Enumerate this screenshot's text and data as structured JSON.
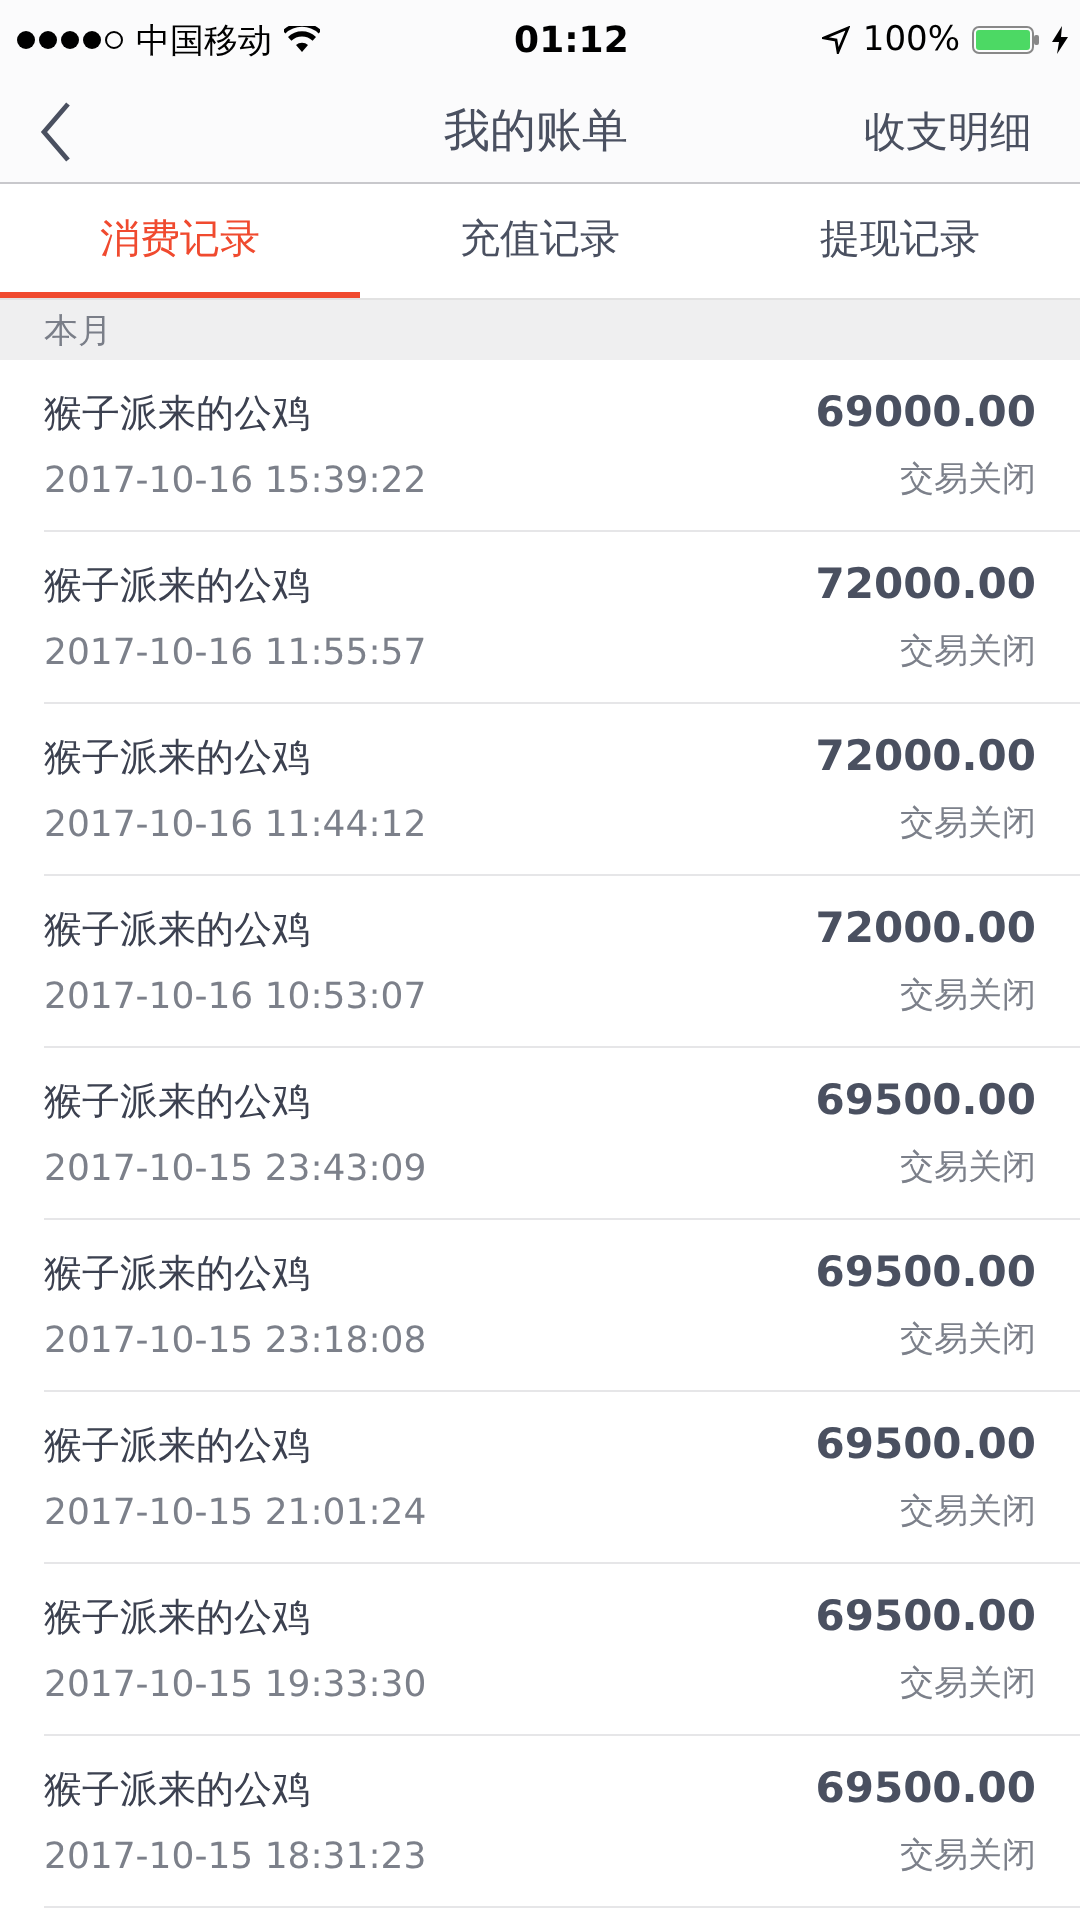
{
  "status_bar": {
    "carrier": "中国移动",
    "time": "01:12",
    "battery": "100%"
  },
  "nav": {
    "title": "我的账单",
    "action": "收支明细"
  },
  "tabs": [
    {
      "label": "消费记录",
      "selected": true
    },
    {
      "label": "充值记录",
      "selected": false
    },
    {
      "label": "提现记录",
      "selected": false
    }
  ],
  "section": "本月",
  "rows": [
    {
      "name": "猴子派来的公鸡",
      "time": "2017-10-16 15:39:22",
      "amount": "69000.00",
      "status": "交易关闭"
    },
    {
      "name": "猴子派来的公鸡",
      "time": "2017-10-16 11:55:57",
      "amount": "72000.00",
      "status": "交易关闭"
    },
    {
      "name": "猴子派来的公鸡",
      "time": "2017-10-16 11:44:12",
      "amount": "72000.00",
      "status": "交易关闭"
    },
    {
      "name": "猴子派来的公鸡",
      "time": "2017-10-16 10:53:07",
      "amount": "72000.00",
      "status": "交易关闭"
    },
    {
      "name": "猴子派来的公鸡",
      "time": "2017-10-15 23:43:09",
      "amount": "69500.00",
      "status": "交易关闭"
    },
    {
      "name": "猴子派来的公鸡",
      "time": "2017-10-15 23:18:08",
      "amount": "69500.00",
      "status": "交易关闭"
    },
    {
      "name": "猴子派来的公鸡",
      "time": "2017-10-15 21:01:24",
      "amount": "69500.00",
      "status": "交易关闭"
    },
    {
      "name": "猴子派来的公鸡",
      "time": "2017-10-15 19:33:30",
      "amount": "69500.00",
      "status": "交易关闭"
    },
    {
      "name": "猴子派来的公鸡",
      "time": "2017-10-15 18:31:23",
      "amount": "69500.00",
      "status": "交易关闭"
    }
  ]
}
